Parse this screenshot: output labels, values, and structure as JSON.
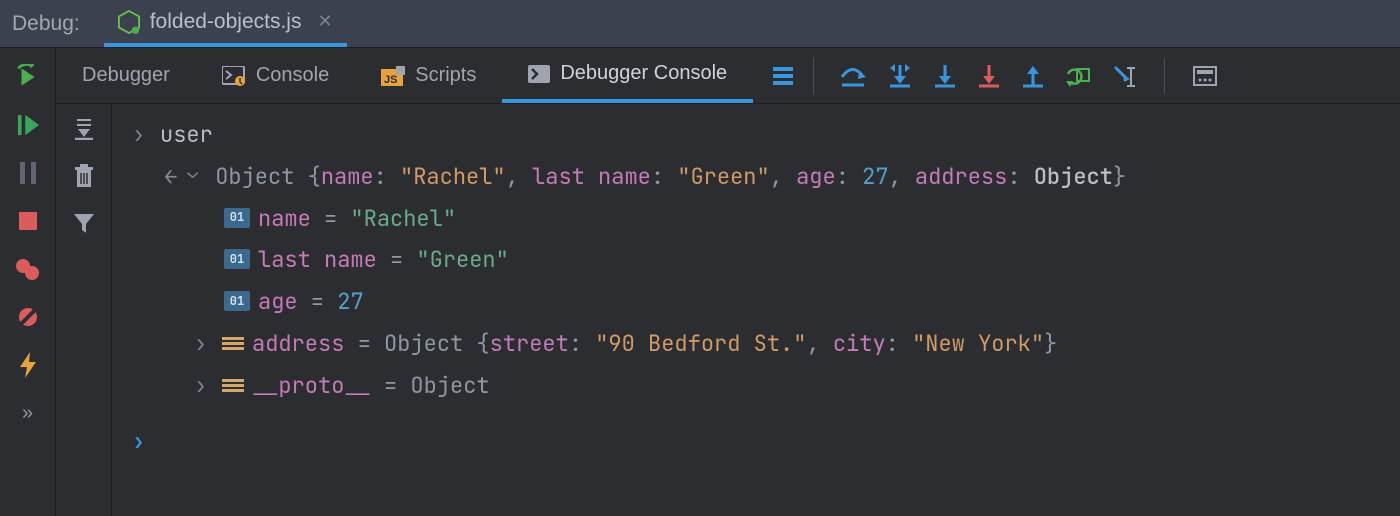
{
  "header": {
    "title": "Debug:",
    "file_name": "folded-objects.js"
  },
  "tabs": {
    "debugger": "Debugger",
    "console": "Console",
    "scripts": "Scripts",
    "debugger_console": "Debugger Console"
  },
  "console": {
    "input_expr": "user",
    "object_label": "Object",
    "object_open": "{",
    "object_close": "}",
    "summary": {
      "name_key": "name",
      "name_val": "\"Rachel\"",
      "last_key": "last name",
      "last_val": "\"Green\"",
      "age_key": "age",
      "age_val": "27",
      "addr_key": "address",
      "addr_val": "Object"
    },
    "props": {
      "name_key": "name",
      "name_val": "\"Rachel\"",
      "last_key": "last name",
      "last_val": "\"Green\"",
      "age_key": "age",
      "age_val": "27",
      "addr_key": "address",
      "addr_type": "Object",
      "addr_open": "{",
      "addr_close": "}",
      "addr_street_key": "street",
      "addr_street_val": "\"90 Bedford St.\"",
      "addr_city_key": "city",
      "addr_city_val": "\"New York\"",
      "proto_key": "__proto__",
      "proto_val": "Object"
    },
    "eq": " = ",
    "colon": ": ",
    "comma": ", "
  },
  "icons": {
    "badge_text": "01"
  }
}
